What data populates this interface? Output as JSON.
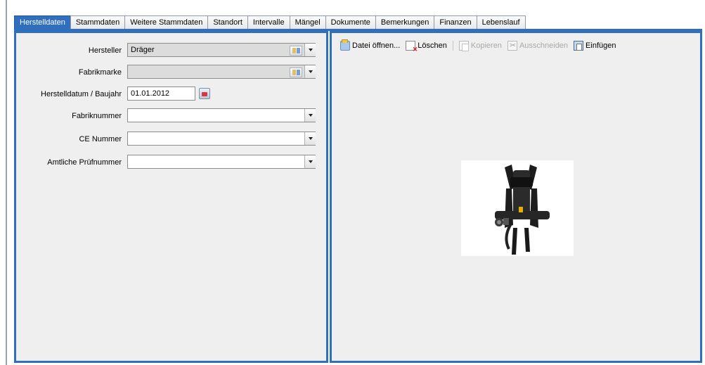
{
  "tabs": [
    {
      "label": "Herstelldaten",
      "active": true
    },
    {
      "label": "Stammdaten",
      "active": false
    },
    {
      "label": "Weitere Stammdaten",
      "active": false
    },
    {
      "label": "Standort",
      "active": false
    },
    {
      "label": "Intervalle",
      "active": false
    },
    {
      "label": "Mängel",
      "active": false
    },
    {
      "label": "Dokumente",
      "active": false
    },
    {
      "label": "Bemerkungen",
      "active": false
    },
    {
      "label": "Finanzen",
      "active": false
    },
    {
      "label": "Lebenslauf",
      "active": false
    }
  ],
  "form": {
    "hersteller": {
      "label": "Hersteller",
      "value": "Dräger"
    },
    "fabrikmarke": {
      "label": "Fabrikmarke",
      "value": ""
    },
    "herstelldatum": {
      "label": "Herstelldatum / Baujahr",
      "value": "01.01.2012"
    },
    "fabriknummer": {
      "label": "Fabriknummer",
      "value": ""
    },
    "ce_nummer": {
      "label": "CE Nummer",
      "value": ""
    },
    "amtliche_pruefnummer": {
      "label": "Amtliche Prüfnummer",
      "value": ""
    }
  },
  "toolbar": {
    "open_label": "Datei öffnen...",
    "delete_label": "Löschen",
    "copy_label": "Kopieren",
    "cut_label": "Ausschneiden",
    "paste_label": "Einfügen"
  },
  "colors": {
    "accent": "#2f6fbd",
    "panel_bg": "#efefef",
    "disabled_text": "#a9a9a9"
  },
  "image": {
    "subject": "breathing-apparatus-harness"
  }
}
